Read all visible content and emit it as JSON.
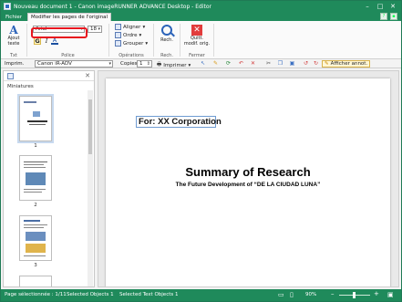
{
  "window": {
    "title": "Nouveau document 1 - Canon imageRUNNER ADVANCE Desktop - Editor"
  },
  "tabs": [
    {
      "label": "Fichier"
    },
    {
      "label": "Modifier les pages de l'original"
    }
  ],
  "ribbon": {
    "text_group": {
      "add_text_label": "Ajout texte",
      "label": "Txt"
    },
    "font_group": {
      "font_name": "Arial",
      "font_size": "18",
      "label": "Police",
      "bold": "G",
      "italic": "I",
      "color": "A"
    },
    "operations_group": {
      "align": "Aligner",
      "order": "Ordre",
      "group": "Grouper",
      "label": "Opérations"
    },
    "search_group": {
      "search": "Rech.",
      "label": "Rech."
    },
    "close_group": {
      "close_label": "Quitt. modif. orig.",
      "label": "Fermer"
    }
  },
  "toolbar2": {
    "printer_label": "Imprim.",
    "printer_value": "Canon iR-ADV",
    "copies_label": "Copies",
    "copies_value": "1",
    "print_button": "Imprimer",
    "show_annotations": "Afficher annot."
  },
  "left_panel": {
    "title": "Miniatures",
    "thumbnails": [
      {
        "number": "1"
      },
      {
        "number": "2"
      },
      {
        "number": "3"
      }
    ]
  },
  "document": {
    "text_box": "For: XX Corporation",
    "title": "Summary of Research",
    "subtitle": "The Future Development of “DE LA CIUDAD LUNA”"
  },
  "status": {
    "page_selected": "Page sélectionnée : 1/11",
    "selected_objects": "Selected Objects 1",
    "selected_text_objects": "Selected Text Objects 1",
    "zoom": "90%"
  }
}
